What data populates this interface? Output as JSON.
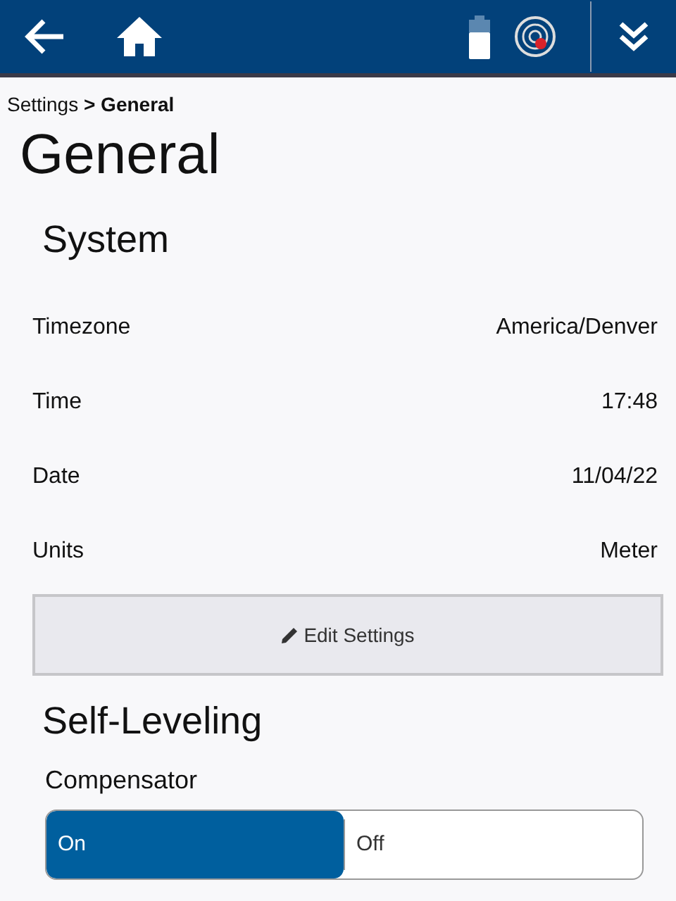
{
  "breadcrumb": "Settings **> General**",
  "title": "General",
  "section": "System",
  "settings": [
    {
      "label": "Timezone",
      "value": "America/Denver"
    },
    {
      "label": "Time",
      "value": "17:48"
    },
    {
      "label": "Date",
      "value": "11/04/22"
    },
    {
      "label": "Units",
      "value": "Meter"
    }
  ],
  "edit_button": "Edit Settings",
  "self_leveling": {
    "title": "Self-Leveling",
    "label": "Compensator",
    "options": [
      {
        "label": "On",
        "selected": true
      },
      {
        "label": "Off",
        "selected": false
      }
    ]
  }
}
